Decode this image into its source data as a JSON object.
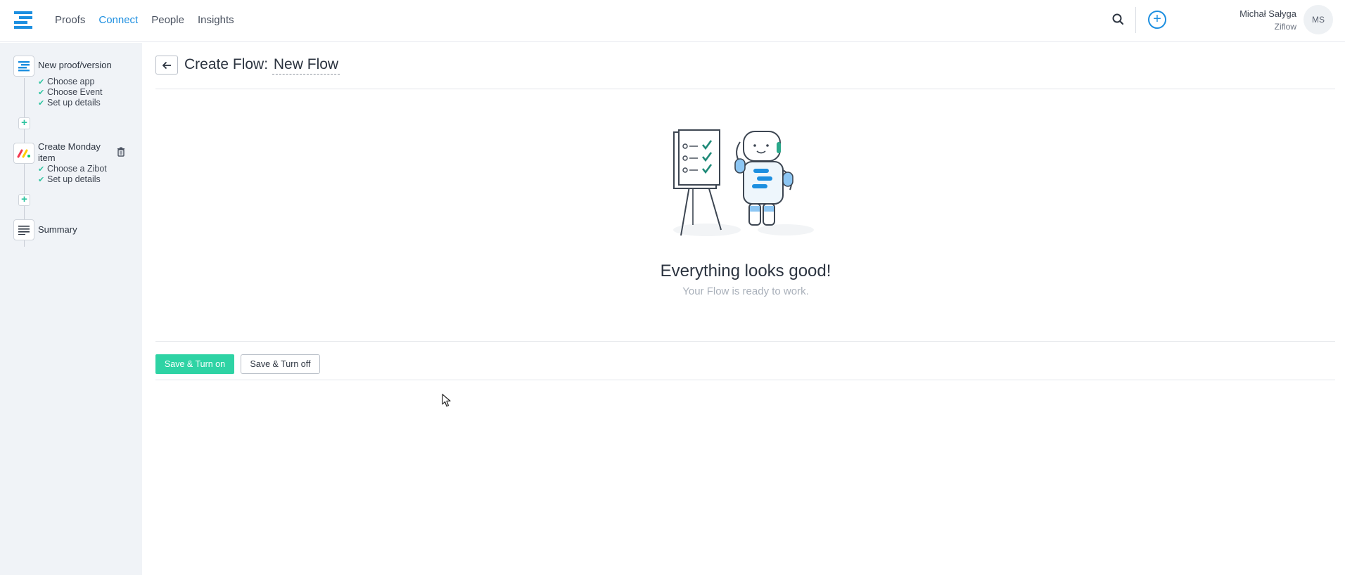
{
  "nav": {
    "items": [
      {
        "label": "Proofs",
        "active": false
      },
      {
        "label": "Connect",
        "active": true
      },
      {
        "label": "People",
        "active": false
      },
      {
        "label": "Insights",
        "active": false
      }
    ],
    "accent_color": "#1d8fe0"
  },
  "user": {
    "name": "Michał Sałyga",
    "org": "Ziflow",
    "initials": "MS"
  },
  "sidebar": {
    "steps": [
      {
        "title": "New proof/version",
        "icon": "ziflow-logo-icon",
        "substeps": [
          "Choose app",
          "Choose Event",
          "Set up details"
        ]
      },
      {
        "title": "Create Monday item",
        "icon": "monday-logo-icon",
        "substeps": [
          "Choose a Zibot",
          "Set up details"
        ]
      },
      {
        "title": "Summary",
        "icon": "summary-lines-icon",
        "substeps": []
      }
    ]
  },
  "main": {
    "title_prefix": "Create Flow:",
    "flow_name": "New Flow",
    "status_title": "Everything looks good!",
    "status_subtitle": "Your Flow is ready to work.",
    "buttons": {
      "save_on": "Save & Turn on",
      "save_off": "Save & Turn off"
    },
    "success_color": "#2ed3a4"
  }
}
